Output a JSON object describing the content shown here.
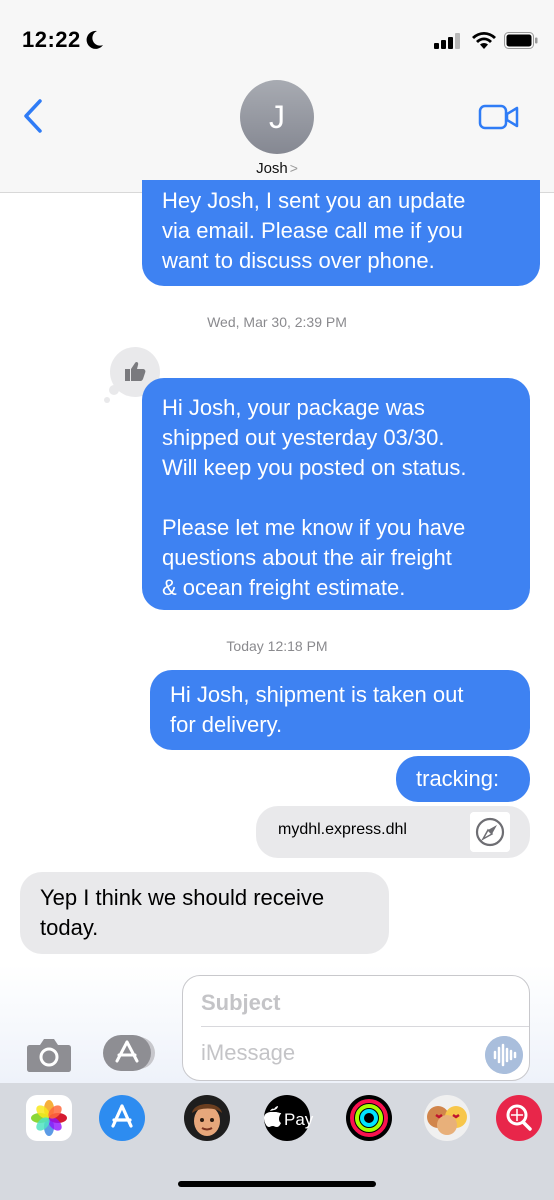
{
  "status_bar": {
    "time": "12:22"
  },
  "header": {
    "avatar_initial": "J",
    "contact_name": "Josh",
    "contact_chevron": ">"
  },
  "messages": {
    "m1": "Hey Josh, I sent you an update\nvia email. Please call me if you\nwant to discuss over phone.",
    "stamp1": "Wed, Mar 30, 2:39 PM",
    "m2": "Hi Josh, your package was\nshipped out yesterday 03/30.\nWill keep you posted on status.\n\nPlease let me know if you have\nquestions about the air freight\n& ocean freight estimate.",
    "stamp2": "Today 12:18 PM",
    "m3": "Hi Josh, shipment is taken out\nfor delivery.",
    "m4": "tracking:",
    "link_text": "mydhl.express.dhl",
    "m5": "Yep I think we should receive\ntoday."
  },
  "input": {
    "subject_placeholder": "Subject",
    "message_placeholder": "iMessage"
  },
  "app_drawer": {
    "apple_pay_label": "Pay",
    "apps": [
      "photos-app",
      "app-store-app",
      "memoji-app",
      "apple-pay-app",
      "activity-app",
      "animoji-app",
      "search-images-app"
    ]
  },
  "colors": {
    "sent_bubble": "#3e82f2",
    "received_bubble": "#e9e9eb",
    "accent": "#2f7cf6"
  }
}
